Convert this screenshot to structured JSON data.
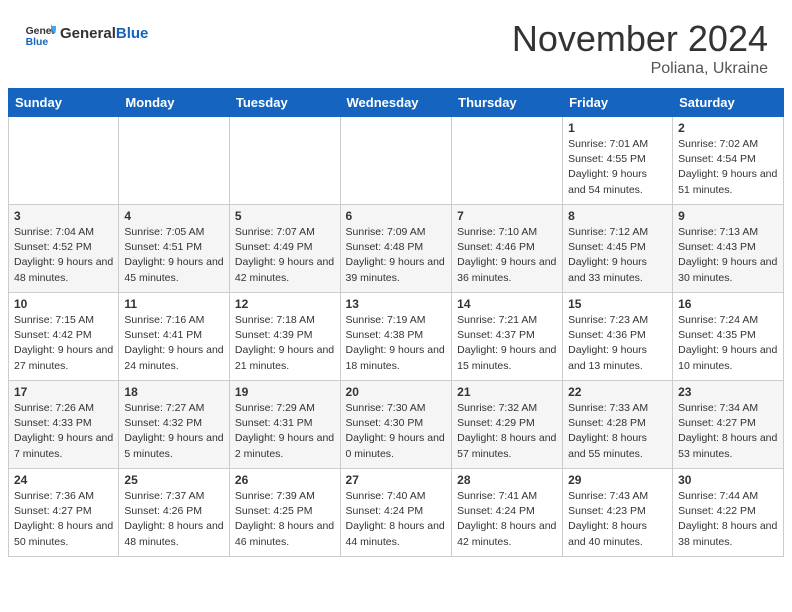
{
  "header": {
    "logo_general": "General",
    "logo_blue": "Blue",
    "month_title": "November 2024",
    "location": "Poliana, Ukraine"
  },
  "days_of_week": [
    "Sunday",
    "Monday",
    "Tuesday",
    "Wednesday",
    "Thursday",
    "Friday",
    "Saturday"
  ],
  "weeks": [
    [
      {
        "day": "",
        "info": ""
      },
      {
        "day": "",
        "info": ""
      },
      {
        "day": "",
        "info": ""
      },
      {
        "day": "",
        "info": ""
      },
      {
        "day": "",
        "info": ""
      },
      {
        "day": "1",
        "info": "Sunrise: 7:01 AM\nSunset: 4:55 PM\nDaylight: 9 hours and 54 minutes."
      },
      {
        "day": "2",
        "info": "Sunrise: 7:02 AM\nSunset: 4:54 PM\nDaylight: 9 hours and 51 minutes."
      }
    ],
    [
      {
        "day": "3",
        "info": "Sunrise: 7:04 AM\nSunset: 4:52 PM\nDaylight: 9 hours and 48 minutes."
      },
      {
        "day": "4",
        "info": "Sunrise: 7:05 AM\nSunset: 4:51 PM\nDaylight: 9 hours and 45 minutes."
      },
      {
        "day": "5",
        "info": "Sunrise: 7:07 AM\nSunset: 4:49 PM\nDaylight: 9 hours and 42 minutes."
      },
      {
        "day": "6",
        "info": "Sunrise: 7:09 AM\nSunset: 4:48 PM\nDaylight: 9 hours and 39 minutes."
      },
      {
        "day": "7",
        "info": "Sunrise: 7:10 AM\nSunset: 4:46 PM\nDaylight: 9 hours and 36 minutes."
      },
      {
        "day": "8",
        "info": "Sunrise: 7:12 AM\nSunset: 4:45 PM\nDaylight: 9 hours and 33 minutes."
      },
      {
        "day": "9",
        "info": "Sunrise: 7:13 AM\nSunset: 4:43 PM\nDaylight: 9 hours and 30 minutes."
      }
    ],
    [
      {
        "day": "10",
        "info": "Sunrise: 7:15 AM\nSunset: 4:42 PM\nDaylight: 9 hours and 27 minutes."
      },
      {
        "day": "11",
        "info": "Sunrise: 7:16 AM\nSunset: 4:41 PM\nDaylight: 9 hours and 24 minutes."
      },
      {
        "day": "12",
        "info": "Sunrise: 7:18 AM\nSunset: 4:39 PM\nDaylight: 9 hours and 21 minutes."
      },
      {
        "day": "13",
        "info": "Sunrise: 7:19 AM\nSunset: 4:38 PM\nDaylight: 9 hours and 18 minutes."
      },
      {
        "day": "14",
        "info": "Sunrise: 7:21 AM\nSunset: 4:37 PM\nDaylight: 9 hours and 15 minutes."
      },
      {
        "day": "15",
        "info": "Sunrise: 7:23 AM\nSunset: 4:36 PM\nDaylight: 9 hours and 13 minutes."
      },
      {
        "day": "16",
        "info": "Sunrise: 7:24 AM\nSunset: 4:35 PM\nDaylight: 9 hours and 10 minutes."
      }
    ],
    [
      {
        "day": "17",
        "info": "Sunrise: 7:26 AM\nSunset: 4:33 PM\nDaylight: 9 hours and 7 minutes."
      },
      {
        "day": "18",
        "info": "Sunrise: 7:27 AM\nSunset: 4:32 PM\nDaylight: 9 hours and 5 minutes."
      },
      {
        "day": "19",
        "info": "Sunrise: 7:29 AM\nSunset: 4:31 PM\nDaylight: 9 hours and 2 minutes."
      },
      {
        "day": "20",
        "info": "Sunrise: 7:30 AM\nSunset: 4:30 PM\nDaylight: 9 hours and 0 minutes."
      },
      {
        "day": "21",
        "info": "Sunrise: 7:32 AM\nSunset: 4:29 PM\nDaylight: 8 hours and 57 minutes."
      },
      {
        "day": "22",
        "info": "Sunrise: 7:33 AM\nSunset: 4:28 PM\nDaylight: 8 hours and 55 minutes."
      },
      {
        "day": "23",
        "info": "Sunrise: 7:34 AM\nSunset: 4:27 PM\nDaylight: 8 hours and 53 minutes."
      }
    ],
    [
      {
        "day": "24",
        "info": "Sunrise: 7:36 AM\nSunset: 4:27 PM\nDaylight: 8 hours and 50 minutes."
      },
      {
        "day": "25",
        "info": "Sunrise: 7:37 AM\nSunset: 4:26 PM\nDaylight: 8 hours and 48 minutes."
      },
      {
        "day": "26",
        "info": "Sunrise: 7:39 AM\nSunset: 4:25 PM\nDaylight: 8 hours and 46 minutes."
      },
      {
        "day": "27",
        "info": "Sunrise: 7:40 AM\nSunset: 4:24 PM\nDaylight: 8 hours and 44 minutes."
      },
      {
        "day": "28",
        "info": "Sunrise: 7:41 AM\nSunset: 4:24 PM\nDaylight: 8 hours and 42 minutes."
      },
      {
        "day": "29",
        "info": "Sunrise: 7:43 AM\nSunset: 4:23 PM\nDaylight: 8 hours and 40 minutes."
      },
      {
        "day": "30",
        "info": "Sunrise: 7:44 AM\nSunset: 4:22 PM\nDaylight: 8 hours and 38 minutes."
      }
    ]
  ]
}
